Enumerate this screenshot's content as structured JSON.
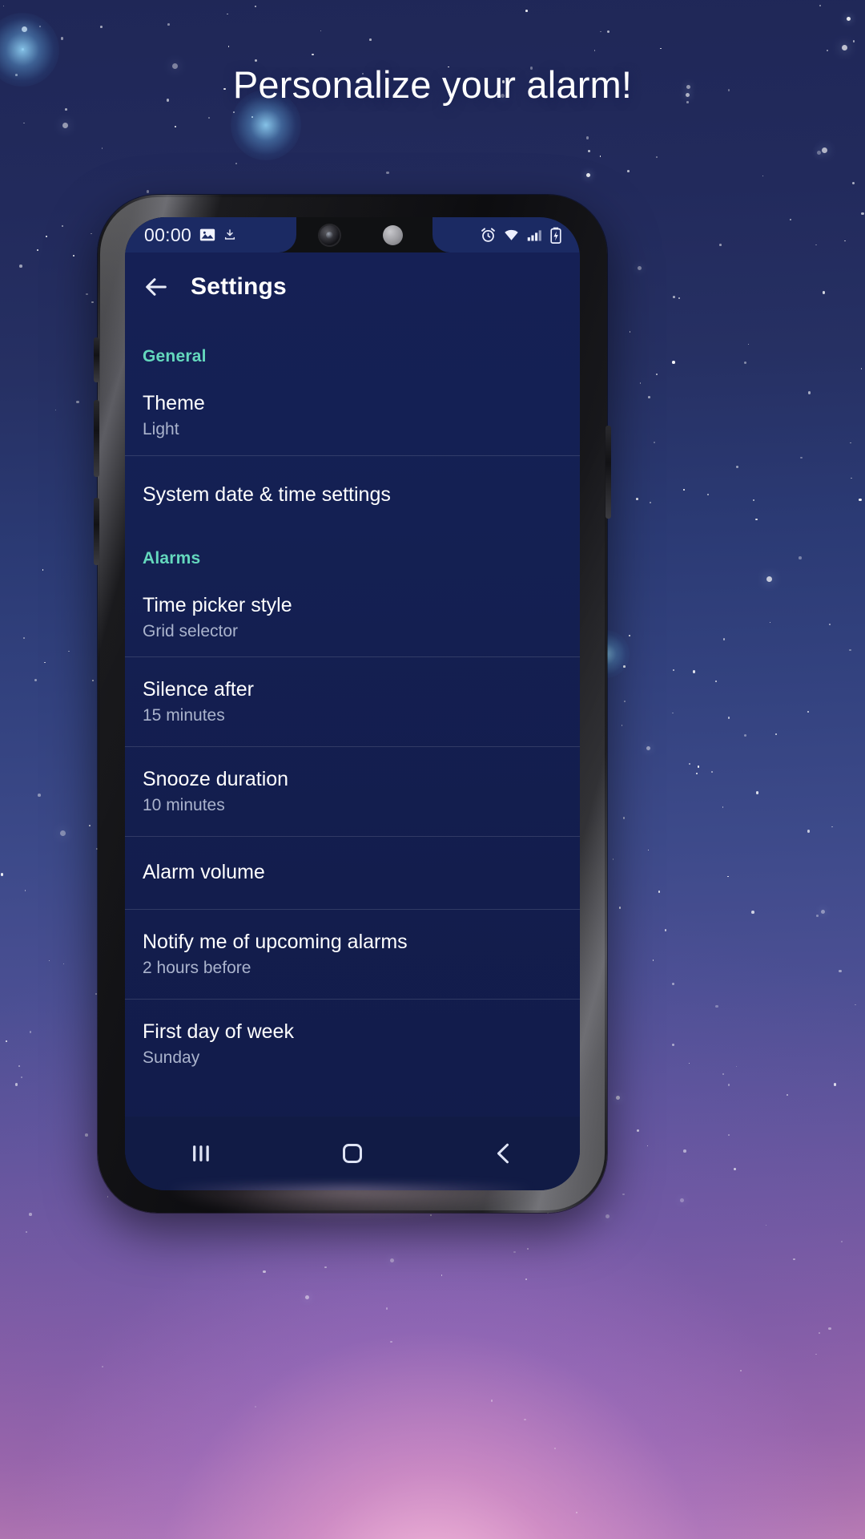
{
  "headline": "Personalize your alarm!",
  "colors": {
    "accent_teal": "#64d8bd",
    "app_background": "#152055",
    "title_white": "#ffffff",
    "subtitle_grey": "#aab3cc",
    "navbar": "#111b45"
  },
  "status_bar": {
    "clock": "00:00",
    "left_icons": [
      "image-icon",
      "download-icon"
    ],
    "right_icons": [
      "alarm-icon",
      "wifi-icon",
      "signal-icon",
      "battery-charging-icon"
    ]
  },
  "appbar": {
    "back_icon": "back-arrow-icon",
    "title": "Settings"
  },
  "sections": [
    {
      "heading": "General",
      "rows": [
        {
          "title": "Theme",
          "subtitle": "Light",
          "divided": false
        },
        {
          "title": "System date & time settings",
          "subtitle": "",
          "divided": true
        }
      ]
    },
    {
      "heading": "Alarms",
      "rows": [
        {
          "title": "Time picker style",
          "subtitle": "Grid selector",
          "divided": false
        },
        {
          "title": "Silence after",
          "subtitle": "15 minutes",
          "divided": true
        },
        {
          "title": "Snooze duration",
          "subtitle": "10 minutes",
          "divided": true
        },
        {
          "title": "Alarm volume",
          "subtitle": "",
          "divided": true
        },
        {
          "title": "Notify me of upcoming alarms",
          "subtitle": "2 hours before",
          "divided": true
        },
        {
          "title": "First day of week",
          "subtitle": "Sunday",
          "divided": true
        }
      ]
    }
  ],
  "navbar": {
    "recents_icon": "recents-icon",
    "home_icon": "home-icon",
    "back_icon": "nav-back-icon"
  }
}
